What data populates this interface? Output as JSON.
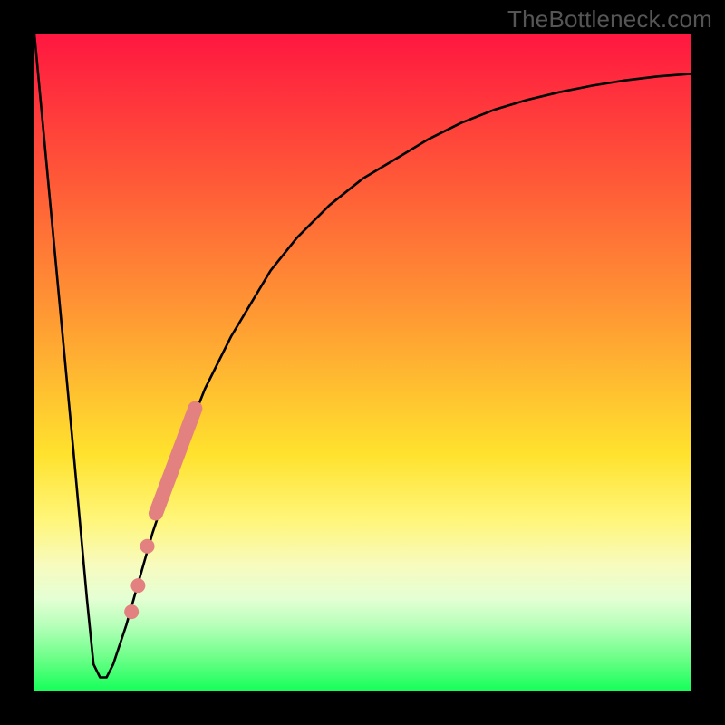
{
  "watermark": "TheBottleneck.com",
  "colors": {
    "frame": "#000000",
    "curve_stroke": "#000000",
    "marker_fill": "#e38080",
    "gradient_stops": [
      "#ff1740",
      "#ff5838",
      "#ff9d33",
      "#ffe22e",
      "#fff67a",
      "#f7fbbf",
      "#e4ffd4",
      "#b7ffba",
      "#6dff89",
      "#16ff5a"
    ]
  },
  "chart_data": {
    "type": "line",
    "title": "",
    "xlabel": "",
    "ylabel": "",
    "xlim": [
      0,
      100
    ],
    "ylim": [
      0,
      100
    ],
    "grid": false,
    "legend": false,
    "series": [
      {
        "name": "bottleneck-curve",
        "x": [
          0,
          3,
          6,
          8,
          9,
          10,
          11,
          12,
          14,
          16,
          18,
          20,
          22,
          24,
          26,
          28,
          30,
          33,
          36,
          40,
          45,
          50,
          55,
          60,
          65,
          70,
          75,
          80,
          85,
          90,
          95,
          100
        ],
        "values": [
          100,
          68,
          36,
          14,
          4,
          2,
          2,
          4,
          10,
          17,
          24,
          30,
          36,
          41,
          46,
          50,
          54,
          59,
          64,
          69,
          74,
          78,
          81,
          84,
          86.5,
          88.5,
          90,
          91.2,
          92.2,
          93,
          93.6,
          94
        ]
      }
    ],
    "markers": [
      {
        "name": "segment-highlight",
        "shape": "thick-segment",
        "x_range": [
          18.5,
          24.5
        ],
        "y_range": [
          27,
          43
        ]
      },
      {
        "name": "dot-1",
        "shape": "dot",
        "x": 17.2,
        "y": 22
      },
      {
        "name": "dot-2",
        "shape": "dot",
        "x": 15.8,
        "y": 16
      },
      {
        "name": "dot-3",
        "shape": "dot",
        "x": 14.8,
        "y": 12
      }
    ]
  }
}
